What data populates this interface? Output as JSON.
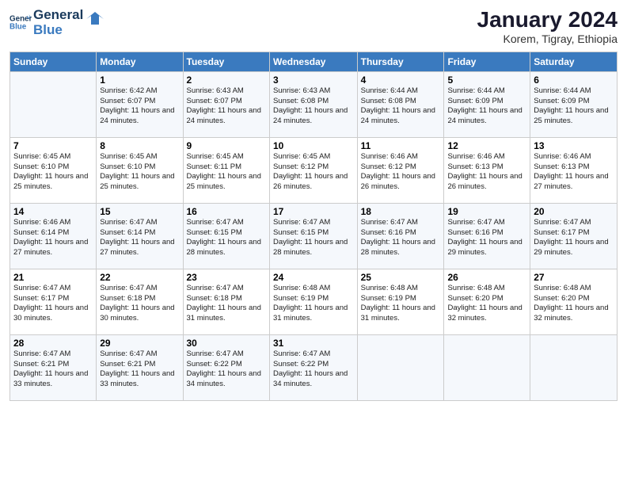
{
  "logo": {
    "line1": "General",
    "line2": "Blue"
  },
  "title": "January 2024",
  "subtitle": "Korem, Tigray, Ethiopia",
  "weekdays": [
    "Sunday",
    "Monday",
    "Tuesday",
    "Wednesday",
    "Thursday",
    "Friday",
    "Saturday"
  ],
  "weeks": [
    [
      {
        "day": "",
        "sunrise": "",
        "sunset": "",
        "daylight": ""
      },
      {
        "day": "1",
        "sunrise": "Sunrise: 6:42 AM",
        "sunset": "Sunset: 6:07 PM",
        "daylight": "Daylight: 11 hours and 24 minutes."
      },
      {
        "day": "2",
        "sunrise": "Sunrise: 6:43 AM",
        "sunset": "Sunset: 6:07 PM",
        "daylight": "Daylight: 11 hours and 24 minutes."
      },
      {
        "day": "3",
        "sunrise": "Sunrise: 6:43 AM",
        "sunset": "Sunset: 6:08 PM",
        "daylight": "Daylight: 11 hours and 24 minutes."
      },
      {
        "day": "4",
        "sunrise": "Sunrise: 6:44 AM",
        "sunset": "Sunset: 6:08 PM",
        "daylight": "Daylight: 11 hours and 24 minutes."
      },
      {
        "day": "5",
        "sunrise": "Sunrise: 6:44 AM",
        "sunset": "Sunset: 6:09 PM",
        "daylight": "Daylight: 11 hours and 24 minutes."
      },
      {
        "day": "6",
        "sunrise": "Sunrise: 6:44 AM",
        "sunset": "Sunset: 6:09 PM",
        "daylight": "Daylight: 11 hours and 25 minutes."
      }
    ],
    [
      {
        "day": "7",
        "sunrise": "Sunrise: 6:45 AM",
        "sunset": "Sunset: 6:10 PM",
        "daylight": "Daylight: 11 hours and 25 minutes."
      },
      {
        "day": "8",
        "sunrise": "Sunrise: 6:45 AM",
        "sunset": "Sunset: 6:10 PM",
        "daylight": "Daylight: 11 hours and 25 minutes."
      },
      {
        "day": "9",
        "sunrise": "Sunrise: 6:45 AM",
        "sunset": "Sunset: 6:11 PM",
        "daylight": "Daylight: 11 hours and 25 minutes."
      },
      {
        "day": "10",
        "sunrise": "Sunrise: 6:45 AM",
        "sunset": "Sunset: 6:12 PM",
        "daylight": "Daylight: 11 hours and 26 minutes."
      },
      {
        "day": "11",
        "sunrise": "Sunrise: 6:46 AM",
        "sunset": "Sunset: 6:12 PM",
        "daylight": "Daylight: 11 hours and 26 minutes."
      },
      {
        "day": "12",
        "sunrise": "Sunrise: 6:46 AM",
        "sunset": "Sunset: 6:13 PM",
        "daylight": "Daylight: 11 hours and 26 minutes."
      },
      {
        "day": "13",
        "sunrise": "Sunrise: 6:46 AM",
        "sunset": "Sunset: 6:13 PM",
        "daylight": "Daylight: 11 hours and 27 minutes."
      }
    ],
    [
      {
        "day": "14",
        "sunrise": "Sunrise: 6:46 AM",
        "sunset": "Sunset: 6:14 PM",
        "daylight": "Daylight: 11 hours and 27 minutes."
      },
      {
        "day": "15",
        "sunrise": "Sunrise: 6:47 AM",
        "sunset": "Sunset: 6:14 PM",
        "daylight": "Daylight: 11 hours and 27 minutes."
      },
      {
        "day": "16",
        "sunrise": "Sunrise: 6:47 AM",
        "sunset": "Sunset: 6:15 PM",
        "daylight": "Daylight: 11 hours and 28 minutes."
      },
      {
        "day": "17",
        "sunrise": "Sunrise: 6:47 AM",
        "sunset": "Sunset: 6:15 PM",
        "daylight": "Daylight: 11 hours and 28 minutes."
      },
      {
        "day": "18",
        "sunrise": "Sunrise: 6:47 AM",
        "sunset": "Sunset: 6:16 PM",
        "daylight": "Daylight: 11 hours and 28 minutes."
      },
      {
        "day": "19",
        "sunrise": "Sunrise: 6:47 AM",
        "sunset": "Sunset: 6:16 PM",
        "daylight": "Daylight: 11 hours and 29 minutes."
      },
      {
        "day": "20",
        "sunrise": "Sunrise: 6:47 AM",
        "sunset": "Sunset: 6:17 PM",
        "daylight": "Daylight: 11 hours and 29 minutes."
      }
    ],
    [
      {
        "day": "21",
        "sunrise": "Sunrise: 6:47 AM",
        "sunset": "Sunset: 6:17 PM",
        "daylight": "Daylight: 11 hours and 30 minutes."
      },
      {
        "day": "22",
        "sunrise": "Sunrise: 6:47 AM",
        "sunset": "Sunset: 6:18 PM",
        "daylight": "Daylight: 11 hours and 30 minutes."
      },
      {
        "day": "23",
        "sunrise": "Sunrise: 6:47 AM",
        "sunset": "Sunset: 6:18 PM",
        "daylight": "Daylight: 11 hours and 31 minutes."
      },
      {
        "day": "24",
        "sunrise": "Sunrise: 6:48 AM",
        "sunset": "Sunset: 6:19 PM",
        "daylight": "Daylight: 11 hours and 31 minutes."
      },
      {
        "day": "25",
        "sunrise": "Sunrise: 6:48 AM",
        "sunset": "Sunset: 6:19 PM",
        "daylight": "Daylight: 11 hours and 31 minutes."
      },
      {
        "day": "26",
        "sunrise": "Sunrise: 6:48 AM",
        "sunset": "Sunset: 6:20 PM",
        "daylight": "Daylight: 11 hours and 32 minutes."
      },
      {
        "day": "27",
        "sunrise": "Sunrise: 6:48 AM",
        "sunset": "Sunset: 6:20 PM",
        "daylight": "Daylight: 11 hours and 32 minutes."
      }
    ],
    [
      {
        "day": "28",
        "sunrise": "Sunrise: 6:47 AM",
        "sunset": "Sunset: 6:21 PM",
        "daylight": "Daylight: 11 hours and 33 minutes."
      },
      {
        "day": "29",
        "sunrise": "Sunrise: 6:47 AM",
        "sunset": "Sunset: 6:21 PM",
        "daylight": "Daylight: 11 hours and 33 minutes."
      },
      {
        "day": "30",
        "sunrise": "Sunrise: 6:47 AM",
        "sunset": "Sunset: 6:22 PM",
        "daylight": "Daylight: 11 hours and 34 minutes."
      },
      {
        "day": "31",
        "sunrise": "Sunrise: 6:47 AM",
        "sunset": "Sunset: 6:22 PM",
        "daylight": "Daylight: 11 hours and 34 minutes."
      },
      {
        "day": "",
        "sunrise": "",
        "sunset": "",
        "daylight": ""
      },
      {
        "day": "",
        "sunrise": "",
        "sunset": "",
        "daylight": ""
      },
      {
        "day": "",
        "sunrise": "",
        "sunset": "",
        "daylight": ""
      }
    ]
  ]
}
